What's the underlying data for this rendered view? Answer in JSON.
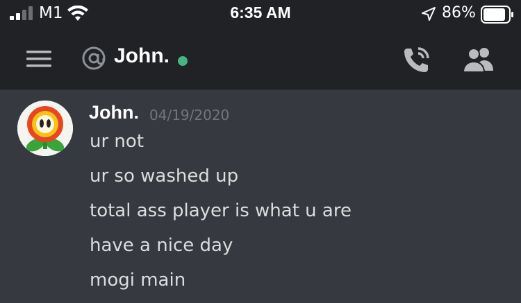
{
  "status_bar": {
    "carrier": "M1",
    "time": "6:35 AM",
    "battery_percent": "86%",
    "signal_bars_filled": 2,
    "signal_bars_total": 4,
    "battery_level": 0.86,
    "icons": [
      "signal-icon",
      "wifi-icon",
      "location-arrow-icon",
      "battery-icon"
    ]
  },
  "header": {
    "channel_name": "John.",
    "status": "online",
    "status_color": "#43b581",
    "icons": [
      "hamburger-menu-icon",
      "at-icon",
      "call-icon",
      "members-icon"
    ]
  },
  "message_group": {
    "author": "John.",
    "timestamp": "04/19/2020",
    "avatar_icon": "fire-flower-avatar",
    "messages": [
      "ur not",
      "ur so washed up",
      "total ass player is what u are",
      "have a nice day",
      "mogi main"
    ]
  },
  "colors": {
    "background": "#36393f",
    "header": "#202225",
    "text": "#dcddde",
    "muted": "#72767d",
    "online": "#43b581"
  }
}
